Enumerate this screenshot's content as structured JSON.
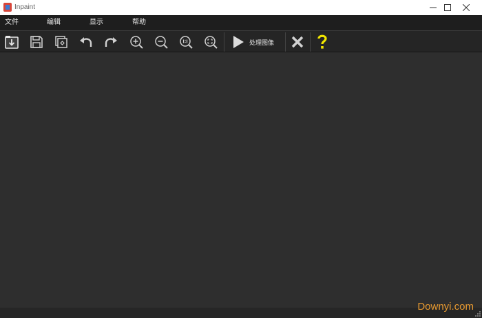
{
  "window": {
    "title": "Inpaint",
    "minimize_icon": "minimize-icon",
    "maximize_icon": "maximize-icon",
    "close_icon": "close-icon"
  },
  "menu": {
    "items": [
      "文件",
      "编辑",
      "显示",
      "帮助"
    ]
  },
  "toolbar": {
    "tools": [
      {
        "name": "open-image",
        "icon": "open-icon"
      },
      {
        "name": "save-image",
        "icon": "save-icon"
      },
      {
        "name": "save-as",
        "icon": "save-as-icon"
      },
      {
        "name": "undo",
        "icon": "undo-icon"
      },
      {
        "name": "redo",
        "icon": "redo-icon"
      },
      {
        "name": "zoom-in",
        "icon": "zoom-in-icon"
      },
      {
        "name": "zoom-out",
        "icon": "zoom-out-icon"
      },
      {
        "name": "zoom-actual",
        "icon": "zoom-1to1-icon"
      },
      {
        "name": "zoom-fit",
        "icon": "zoom-fit-icon"
      }
    ],
    "process_label": "处理图像",
    "process_icon": "play-icon",
    "cancel_icon": "cancel-icon",
    "help_icon": "help-icon"
  },
  "colors": {
    "background": "#2d2d2d",
    "menubar": "#1e1e1e",
    "toolbar": "#252525",
    "help_accent": "#f2e600",
    "watermark": "#e89a30"
  },
  "watermark": "Downyi.com"
}
